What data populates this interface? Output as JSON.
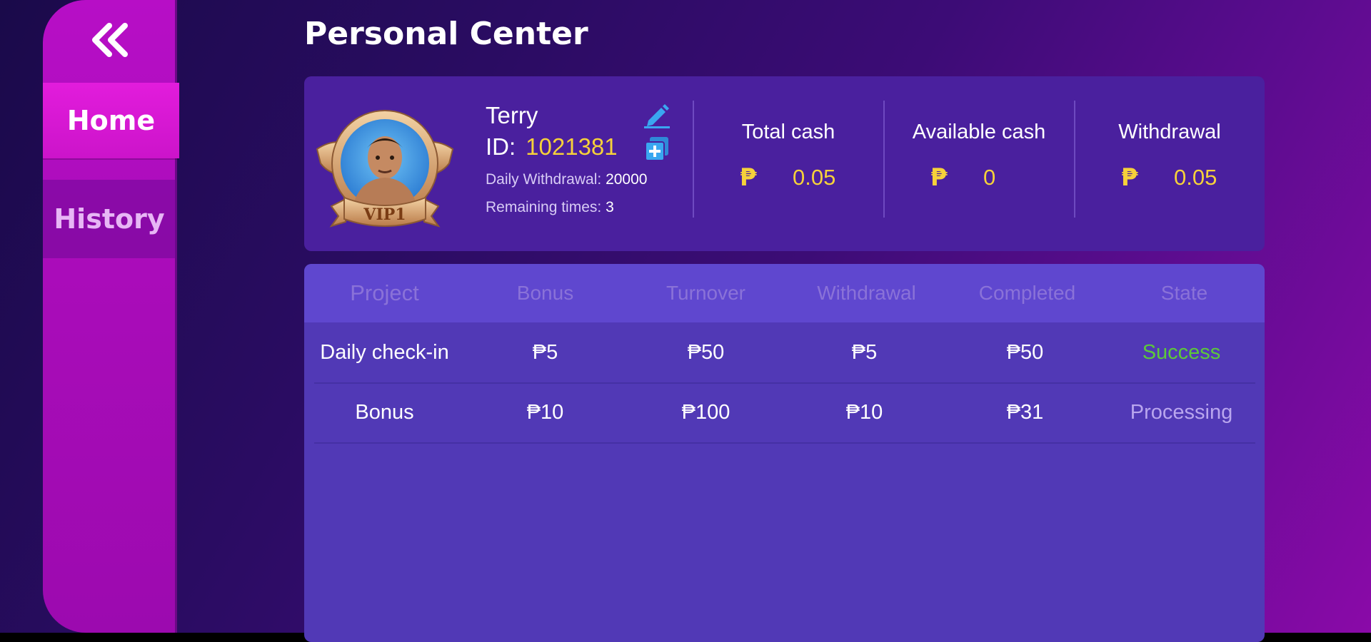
{
  "header": {
    "title": "Personal Center"
  },
  "sidebar": {
    "back_icon": "double-chevron-left-icon",
    "items": [
      {
        "label": "Home",
        "active": true
      },
      {
        "label": "History",
        "active": false
      }
    ]
  },
  "profile": {
    "name": "Terry",
    "id_label": "ID:",
    "id_value": "1021381",
    "vip_badge": "VIP1",
    "daily_withdrawal_label": "Daily Withdrawal:",
    "daily_withdrawal_value": "20000",
    "remaining_times_label": "Remaining times:",
    "remaining_times_value": "3",
    "edit_icon": "pencil-icon",
    "copy_icon": "copy-icon"
  },
  "cash": [
    {
      "title": "Total cash",
      "currency": "₱",
      "value": "0.05"
    },
    {
      "title": "Available cash",
      "currency": "₱",
      "value": "0"
    },
    {
      "title": "Withdrawal",
      "currency": "₱",
      "value": "0.05"
    }
  ],
  "table": {
    "headers": [
      "Project",
      "Bonus",
      "Turnover",
      "Withdrawal",
      "Completed",
      "State"
    ],
    "rows": [
      {
        "project": "Daily check-in",
        "bonus": "₱5",
        "turnover": "₱50",
        "withdrawal": "₱5",
        "completed": "₱50",
        "state": "Success"
      },
      {
        "project": "Bonus",
        "bonus": "₱10",
        "turnover": "₱100",
        "withdrawal": "₱10",
        "completed": "₱31",
        "state": "Processing"
      }
    ]
  },
  "colors": {
    "accent_gold": "#f6d13a",
    "success_green": "#5cc93a",
    "processing_lavender": "#b9a6ee",
    "sidebar_magenta": "#b70ec6",
    "card_purple": "#4a209e"
  }
}
